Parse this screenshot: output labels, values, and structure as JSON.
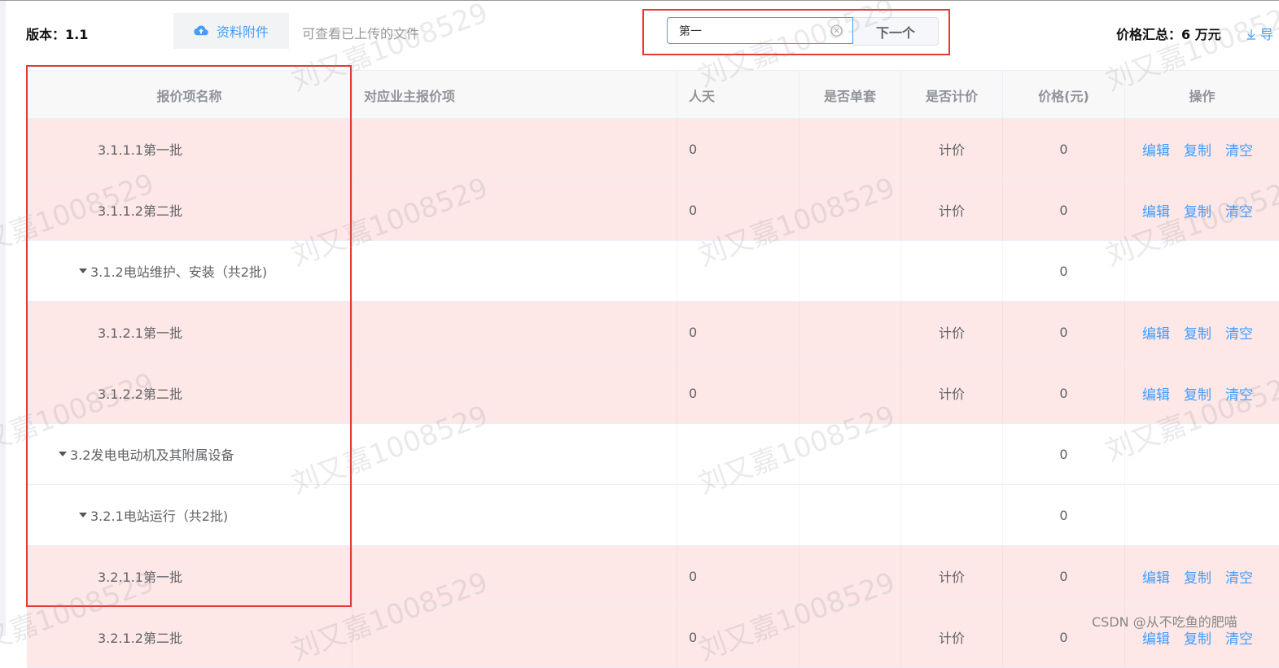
{
  "toolbar": {
    "version_label": "版本：",
    "version_value": "1.1",
    "attach_label": "资料附件",
    "attach_hint": "可查看已上传的文件",
    "search_value": "第一",
    "next_label": "下一个",
    "price_total_label": "价格汇总：",
    "price_total_value": "6 万元",
    "export_label": "导"
  },
  "table": {
    "headers": [
      "报价项名称",
      "对应业主报价项",
      "人天",
      "是否单套",
      "是否计价",
      "价格(元)",
      "操作"
    ],
    "rows": [
      {
        "name": "3.1.1.1第一批",
        "indent": 2,
        "expand": false,
        "owner_item": "",
        "days": "0",
        "single": "",
        "priced": "计价",
        "price": "0",
        "ops": true,
        "highlight": true
      },
      {
        "name": "3.1.1.2第二批",
        "indent": 2,
        "expand": false,
        "owner_item": "",
        "days": "0",
        "single": "",
        "priced": "计价",
        "price": "0",
        "ops": true,
        "highlight": true
      },
      {
        "name": "3.1.2电站维护、安装（共2批)",
        "indent": 1,
        "expand": true,
        "owner_item": "",
        "days": "",
        "single": "",
        "priced": "",
        "price": "0",
        "ops": false,
        "highlight": false
      },
      {
        "name": "3.1.2.1第一批",
        "indent": 2,
        "expand": false,
        "owner_item": "",
        "days": "0",
        "single": "",
        "priced": "计价",
        "price": "0",
        "ops": true,
        "highlight": true
      },
      {
        "name": "3.1.2.2第二批",
        "indent": 2,
        "expand": false,
        "owner_item": "",
        "days": "0",
        "single": "",
        "priced": "计价",
        "price": "0",
        "ops": true,
        "highlight": true
      },
      {
        "name": "3.2发电电动机及其附属设备",
        "indent": 0,
        "expand": true,
        "owner_item": "",
        "days": "",
        "single": "",
        "priced": "",
        "price": "0",
        "ops": false,
        "highlight": false
      },
      {
        "name": "3.2.1电站运行（共2批)",
        "indent": 1,
        "expand": true,
        "owner_item": "",
        "days": "",
        "single": "",
        "priced": "",
        "price": "0",
        "ops": false,
        "highlight": false
      },
      {
        "name": "3.2.1.1第一批",
        "indent": 2,
        "expand": false,
        "owner_item": "",
        "days": "0",
        "single": "",
        "priced": "计价",
        "price": "0",
        "ops": true,
        "highlight": true
      },
      {
        "name": "3.2.1.2第二批",
        "indent": 2,
        "expand": false,
        "owner_item": "",
        "days": "0",
        "single": "",
        "priced": "计价",
        "price": "0",
        "ops": true,
        "highlight": true
      }
    ],
    "ops_labels": [
      "编辑",
      "复制",
      "清空"
    ]
  },
  "watermark": "刘又嘉1008529",
  "footer_credit": "CSDN @从不吃鱼的肥喵",
  "colors": {
    "primary": "#409eff",
    "row_highlight": "#fde7e7",
    "annotation_red": "#e53935"
  },
  "icons": {
    "upload": "cloud-upload-icon",
    "clear": "circle-close-icon",
    "expand": "caret-down-icon",
    "export": "download-arrow-icon"
  }
}
